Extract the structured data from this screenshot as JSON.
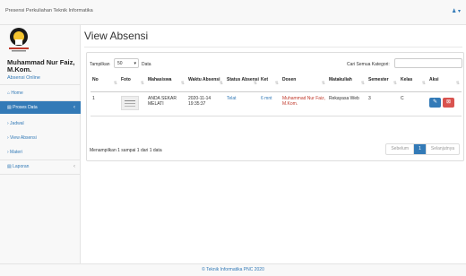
{
  "app": {
    "brand": "Presensi Perkuliahan Teknik Informatika",
    "user_menu": "♟ ▾"
  },
  "sidebar": {
    "user_name": "Muhammad Nur Faiz, M.Kom.",
    "status": "Absensi Online",
    "items": [
      {
        "label": "⌂ Home"
      },
      {
        "label": "▤ Proses Data",
        "chevron": "‹"
      },
      {
        "label": "› Jadwal"
      },
      {
        "label": "› View Absensi"
      },
      {
        "label": "› Materi"
      },
      {
        "label": "▤ Laporan",
        "chevron": "‹"
      }
    ]
  },
  "main": {
    "title": "View Absensi",
    "table_controls": {
      "show": "Tampilkan",
      "length": "50",
      "data": "Data",
      "search_label": "Cari Semua Kategori:"
    },
    "columns": [
      "No",
      "Foto",
      "Mahasiswa",
      "Waktu Absensi",
      "Status Absensi",
      "Ket",
      "Dosen",
      "Matakuliah",
      "Semester",
      "Kelas",
      "Aksi"
    ],
    "rows": [
      {
        "no": "1",
        "mahasiswa": "ANDA SEKAR MELATI",
        "waktu": "2020-11-14 19:35:37",
        "status": "Telat",
        "ket": "6 mnt",
        "dosen": "Muhammad Nur Faiz, M.Kom.",
        "matakuliah": "Rekayasa Web",
        "semester": "3",
        "kelas": "C"
      }
    ],
    "actions": {
      "edit": "✎",
      "delete": "⊠"
    },
    "info": "Menampilkan 1 sampai 1 dari 1 data",
    "pager": {
      "prev": "Sebelum",
      "current": "1",
      "next": "Selanjutnya"
    }
  },
  "footer": "© Teknik Informatika PNC 2020"
}
